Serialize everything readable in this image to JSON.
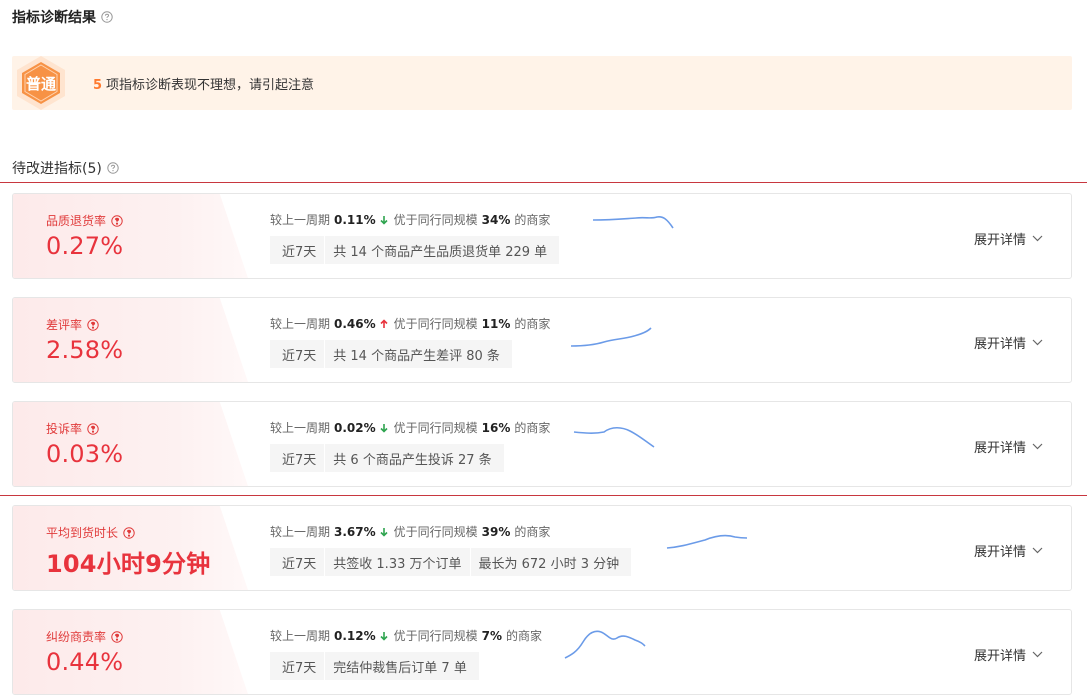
{
  "header": {
    "title": "指标诊断结果"
  },
  "summary": {
    "badge": "普通",
    "count": "5",
    "text": "项指标诊断表现不理想，请引起注意"
  },
  "subsection": {
    "title": "待改进指标(5)"
  },
  "colors": {
    "danger": "#e8333d",
    "up": "#e8333d",
    "down": "#2ea44f",
    "accent": "#ff7a2f",
    "spark": "#6b9be8"
  },
  "metrics": [
    {
      "label": "品质退货率",
      "value": "0.27%",
      "compare_label": "较上一周期",
      "change": "0.11%",
      "direction": "down",
      "peer_label": "优于同行同规模",
      "peer_pct": "34%",
      "peer_suffix": "的商家",
      "period": "近7天",
      "detail": "共 14 个商品产生品质退货单 229 单",
      "detail2": "",
      "expand": "展开详情"
    },
    {
      "label": "差评率",
      "value": "2.58%",
      "compare_label": "较上一周期",
      "change": "0.46%",
      "direction": "up",
      "peer_label": "优于同行同规模",
      "peer_pct": "11%",
      "peer_suffix": "的商家",
      "period": "近7天",
      "detail": "共 14 个商品产生差评 80 条",
      "detail2": "",
      "expand": "展开详情"
    },
    {
      "label": "投诉率",
      "value": "0.03%",
      "compare_label": "较上一周期",
      "change": "0.02%",
      "direction": "down",
      "peer_label": "优于同行同规模",
      "peer_pct": "16%",
      "peer_suffix": "的商家",
      "period": "近7天",
      "detail": "共 6 个商品产生投诉 27 条",
      "detail2": "",
      "expand": "展开详情"
    },
    {
      "label": "平均到货时长",
      "value": "104小时9分钟",
      "compare_label": "较上一周期",
      "change": "3.67%",
      "direction": "down",
      "peer_label": "优于同行同规模",
      "peer_pct": "39%",
      "peer_suffix": "的商家",
      "period": "近7天",
      "detail": "共签收 1.33 万个订单",
      "detail2": "最长为 672 小时 3 分钟",
      "expand": "展开详情"
    },
    {
      "label": "纠纷商责率",
      "value": "0.44%",
      "compare_label": "较上一周期",
      "change": "0.12%",
      "direction": "down",
      "peer_label": "优于同行同规模",
      "peer_pct": "7%",
      "peer_suffix": "的商家",
      "period": "近7天",
      "detail": "完结仲裁售后订单 7 单",
      "detail2": "",
      "expand": "展开详情"
    }
  ]
}
